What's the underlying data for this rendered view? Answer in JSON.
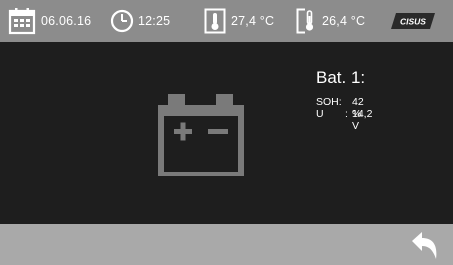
{
  "status_bar": {
    "date": "06.06.16",
    "time": "12:25",
    "temp_inside": "27,4 °C",
    "temp_outside": "26,4 °C",
    "brand_logo_text": "CISUS"
  },
  "battery": {
    "title": "Bat. 1:",
    "soh_label": "SOH:",
    "soh_value": "42 %",
    "u_label": "U",
    "u_sep": ":",
    "u_value": "14,2 V"
  },
  "colors": {
    "top_bar": "#8c8c8c",
    "main_bg": "#1e1e1e",
    "bottom_bar": "#a9a9a9",
    "battery_icon": "#7a7a7a",
    "text": "#ffffff"
  },
  "icons": {
    "calendar": "calendar-icon",
    "clock": "clock-icon",
    "thermometer_in": "thermometer-icon",
    "thermometer_out": "thermometer-outside-icon",
    "battery": "battery-icon",
    "back": "back-arrow-icon"
  }
}
